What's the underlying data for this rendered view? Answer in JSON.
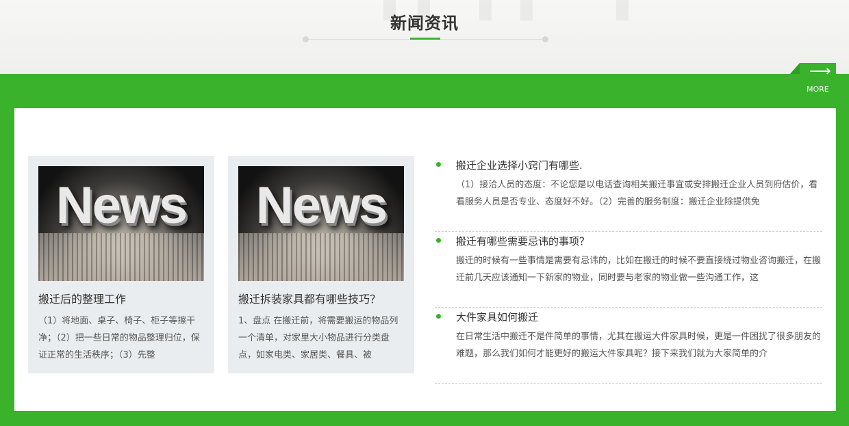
{
  "section": {
    "title": "新闻资讯"
  },
  "more": {
    "arrow": "⟶",
    "label": "MORE"
  },
  "cards": [
    {
      "image_text": "News",
      "title": "搬迁后的整理工作",
      "desc": "（1）将地面、桌子、椅子、柜子等擦干净；（2）把一些日常的物品整理归位，保证正常的生活秩序；（3）先整"
    },
    {
      "image_text": "News",
      "title": "搬迁拆装家具都有哪些技巧？",
      "desc": "1、盘点 在搬迁前，将需要搬运的物品列一个清单，对家里大小物品进行分类盘点，如家电类、家居类、餐具、被"
    }
  ],
  "news": [
    {
      "title": "搬迁企业选择小窍门有哪些.",
      "desc": "（1）接洽人员的态度：不论您是以电话查询相关搬迁事宜或安排搬迁企业人员到府估价，看看服务人员是否专业、态度好不好。（2）完善的服务制度：搬迁企业除提供免"
    },
    {
      "title": "搬迁有哪些需要忌讳的事项？",
      "desc": "搬迁的时候有一些事情是需要有忌讳的，比如在搬迁的时候不要直接绕过物业咨询搬迁，在搬迁前几天应该通知一下新家的物业，同时要与老家的物业做一些沟通工作，这"
    },
    {
      "title": "大件家具如何搬迁",
      "desc": "在日常生活中搬迁不是件简单的事情，尤其在搬运大件家具时候，更是一件困扰了很多朋友的难题，那么我们如何才能更好的搬运大件家具呢？接下来我们就为大家简单的介"
    }
  ],
  "colors": {
    "accent": "#3ab22c",
    "panel": "#ffffff",
    "card_bg": "#eaedef"
  }
}
